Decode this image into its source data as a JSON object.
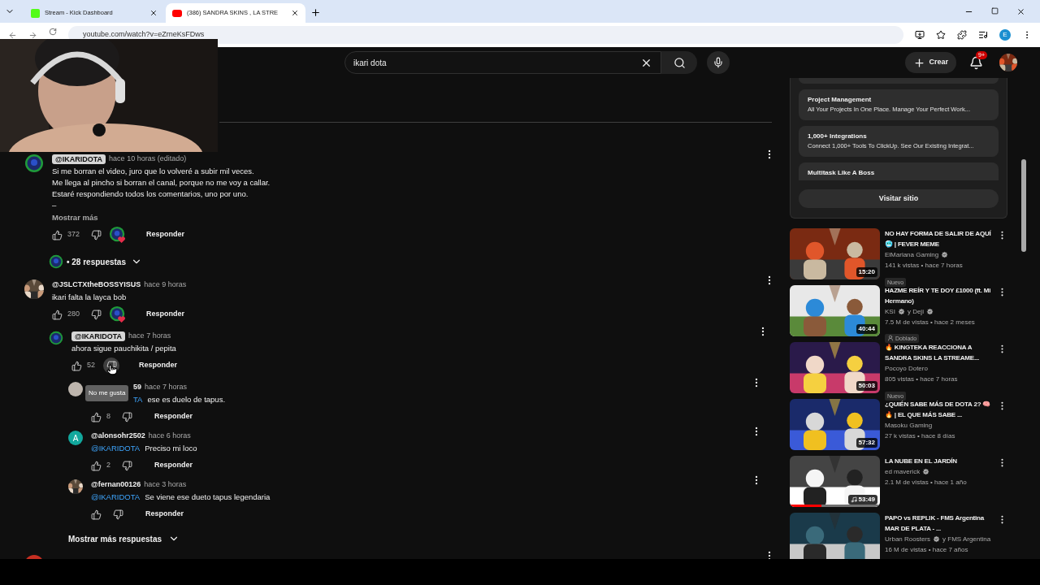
{
  "browser": {
    "tabs": [
      {
        "title": "Stream - Kick Dashboard",
        "selected": false,
        "kind": "kick"
      },
      {
        "title": "(386) SANDRA SKINS , LA STRE",
        "selected": true,
        "kind": "youtube"
      }
    ],
    "url": "youtube.com/watch?v=eZrneKsFDws",
    "profile": "E"
  },
  "header": {
    "search": {
      "value": "ikari dota"
    },
    "create": "Crear",
    "notifications": "9+"
  },
  "comments": [
    {
      "author": "@IKARIDOTA",
      "owner": true,
      "time": "hace 10 horas (editado)",
      "avatar": {
        "kind": "creator"
      },
      "lines": [
        "Si me borran el video, juro que lo volveré a subir mil veces.",
        "Me llega al pincho si borran el canal, porque no me voy a callar.",
        "Estaré respondiendo todos los comentarios, uno por uno.",
        "–"
      ],
      "show_more": "Mostrar más",
      "likes": "372",
      "hearted": true,
      "reply": "Responder",
      "replies_toggle": "• 28 respuestas"
    },
    {
      "author": "@JSLCTXtheBOSSYISUS",
      "owner": false,
      "time": "hace 9 horas",
      "avatar": {
        "kind": "picture"
      },
      "lines": [
        "ikari falta la layca bob"
      ],
      "likes": "280",
      "hearted": true,
      "reply": "Responder",
      "children": [
        {
          "author": "@IKARIDOTA",
          "owner": true,
          "time": "hace 7 horas",
          "avatar": {
            "kind": "creator"
          },
          "lines": [
            "ahora sigue pauchikita / pepita"
          ],
          "likes": "52",
          "hearted": false,
          "dislike_hovered": true,
          "tooltip": "No me gusta",
          "reply": "Responder",
          "children": [
            {
              "author": "59",
              "owner": false,
              "time": "hace 7 horas",
              "avatar": {
                "kind": "letter",
                "color": "#bdb5ad"
              },
              "under_tooltip": true,
              "mention": "TA",
              "lines": [
                "ese es duelo de tapus."
              ],
              "likes": "8",
              "hearted": false,
              "reply": "Responder"
            },
            {
              "author": "@alonsohr2502",
              "owner": false,
              "time": "hace 6 horas",
              "avatar": {
                "kind": "letter",
                "letter": "A",
                "color": "#12a89d"
              },
              "mention": "@IKARIDOTA",
              "lines": [
                "Preciso mi loco"
              ],
              "likes": "2",
              "hearted": false,
              "reply": "Responder"
            },
            {
              "author": "@fernan00126",
              "owner": false,
              "time": "hace 3 horas",
              "avatar": {
                "kind": "picture"
              },
              "mention": "@IKARIDOTA",
              "lines": [
                "Se viene ese dueto tapus legendaria"
              ],
              "hearted": false,
              "reply": "Responder"
            }
          ]
        }
      ],
      "more_replies": "Mostrar más respuestas"
    },
    {
      "avatar": {
        "kind": "letter",
        "color": "#c62f22"
      }
    }
  ],
  "ad": {
    "items": [
      {
        "title": "Project Management",
        "description": "All Your Projects In One Place. Manage Your Perfect Work..."
      },
      {
        "title": "1,000+ Integrations",
        "description": "Connect 1,000+ Tools To ClickUp. See Our Existing Integrat..."
      },
      {
        "title": "Multitask Like A Boss"
      }
    ],
    "button": "Visitar sitio"
  },
  "videos": [
    {
      "title": "NO HAY FORMA DE SALIR DE AQUÍ 🥶 | FEVER MEME",
      "channels": [
        {
          "name": "ElMariana Gaming",
          "verified": true
        }
      ],
      "meta": "141 k vistas • hace 7 horas",
      "badge": {
        "kind": "new",
        "label": "Nuevo"
      },
      "duration": "15:20"
    },
    {
      "title": "HAZME REÍR Y TE DOY £1000 (ft. Mi Hermano)",
      "channels": [
        {
          "name": "KSI",
          "verified": true
        },
        {
          "name": "y Deji",
          "verified": true
        }
      ],
      "meta": "7.5 M de vistas • hace 2 meses",
      "badge": {
        "kind": "dubbed",
        "label": "Doblado"
      },
      "duration": "40:44"
    },
    {
      "title": "🔥 KINGTEKA REACCIONA  A SANDRA SKINS LA STREAME...",
      "channels": [
        {
          "name": "Pocoyo Dotero",
          "verified": false
        }
      ],
      "meta": "805 vistas • hace 7 horas",
      "badge": {
        "kind": "new",
        "label": "Nuevo"
      },
      "duration": "50:03"
    },
    {
      "title": "¿QUIÉN SABE MÁS DE DOTA 2? 🧠 🔥 | EL QUE MÁS SABE ...",
      "channels": [
        {
          "name": "Masoku Gaming",
          "verified": false
        }
      ],
      "meta": "27 k vistas • hace 8 días",
      "duration": "57:32"
    },
    {
      "title": "LA NUBE EN EL JARDÍN",
      "channels": [
        {
          "name": "ed maverick",
          "verified": true
        }
      ],
      "meta": "2.1 M de vistas • hace 1 año",
      "duration": "53:49",
      "music": true,
      "level": 0.35
    },
    {
      "title": "PAPO vs REPLIK - FMS Argentina MAR DE PLATA - ...",
      "channels": [
        {
          "name": "Urban Roosters",
          "verified": true
        },
        {
          "name": "y FMS Argentina",
          "verified": false
        }
      ],
      "meta": "16 M de vistas • hace 7 años"
    }
  ]
}
